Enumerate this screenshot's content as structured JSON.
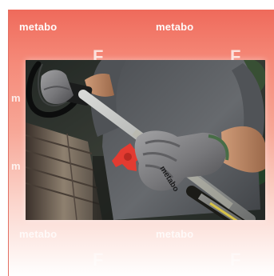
{
  "branding": {
    "watermark_text": "metabo",
    "ghost_symbol": "F"
  },
  "photo": {
    "overlay_text": "metabo"
  },
  "colors": {
    "brand_red": "#ef6a5b",
    "shirt_gray": "#5b5d60",
    "glove_gray": "#8c8b8c",
    "accent_red": "#e33b31",
    "tool_yellow": "#d8c348"
  }
}
